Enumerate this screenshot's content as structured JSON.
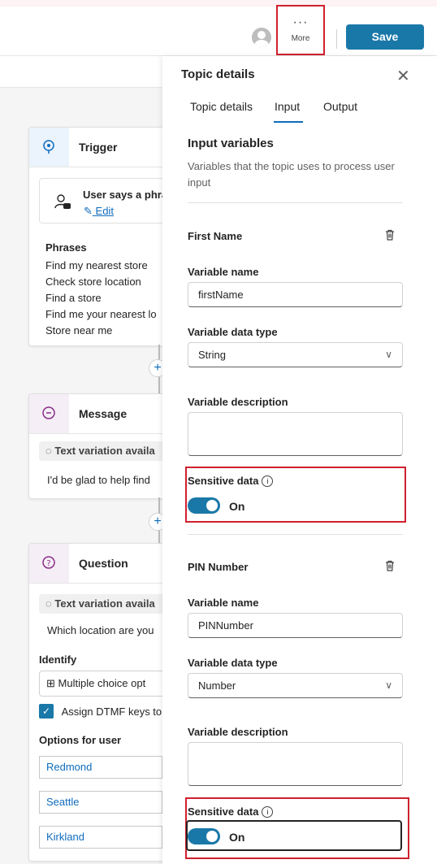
{
  "header": {
    "more_label": "More",
    "more_dots": "···",
    "save_label": "Save"
  },
  "canvas": {
    "trigger": {
      "title": "Trigger",
      "user_says": "User says a phra",
      "edit_label": "Edit",
      "phrases_label": "Phrases",
      "phrases": [
        "Find my nearest store",
        "Check store location",
        "Find a store",
        "Find me your nearest lo",
        "Store near me"
      ]
    },
    "message": {
      "title": "Message",
      "variation_label": "Text variation availa",
      "text": "I'd be glad to help find"
    },
    "question": {
      "title": "Question",
      "variation_label": "Text variation availa",
      "text": "Which location are you",
      "identify_label": "Identify",
      "identify_value": "Multiple choice opt",
      "dtmf_label": "Assign DTMF keys to",
      "options_label": "Options for user",
      "options": [
        "Redmond",
        "Seattle",
        "Kirkland"
      ]
    },
    "plus_symbol": "+"
  },
  "panel": {
    "title": "Topic details",
    "close_symbol": "✕",
    "tabs": [
      {
        "label": "Topic details"
      },
      {
        "label": "Input",
        "active": true
      },
      {
        "label": "Output"
      }
    ],
    "section_title": "Input variables",
    "section_desc": "Variables that the topic uses to process user input",
    "variables": [
      {
        "name": "First Name",
        "var_name_label": "Variable name",
        "var_name_value": "firstName",
        "data_type_label": "Variable data type",
        "data_type_value": "String",
        "desc_label": "Variable description",
        "sensitive_label": "Sensitive data",
        "toggle_label": "On",
        "toggle_on": true
      },
      {
        "name": "PIN Number",
        "var_name_label": "Variable name",
        "var_name_value": "PINNumber",
        "data_type_label": "Variable data type",
        "data_type_value": "Number",
        "desc_label": "Variable description",
        "sensitive_label": "Sensitive data",
        "toggle_label": "On",
        "toggle_on": true
      }
    ]
  },
  "colors": {
    "accent": "#1a78a8",
    "highlight": "#d0202e"
  }
}
